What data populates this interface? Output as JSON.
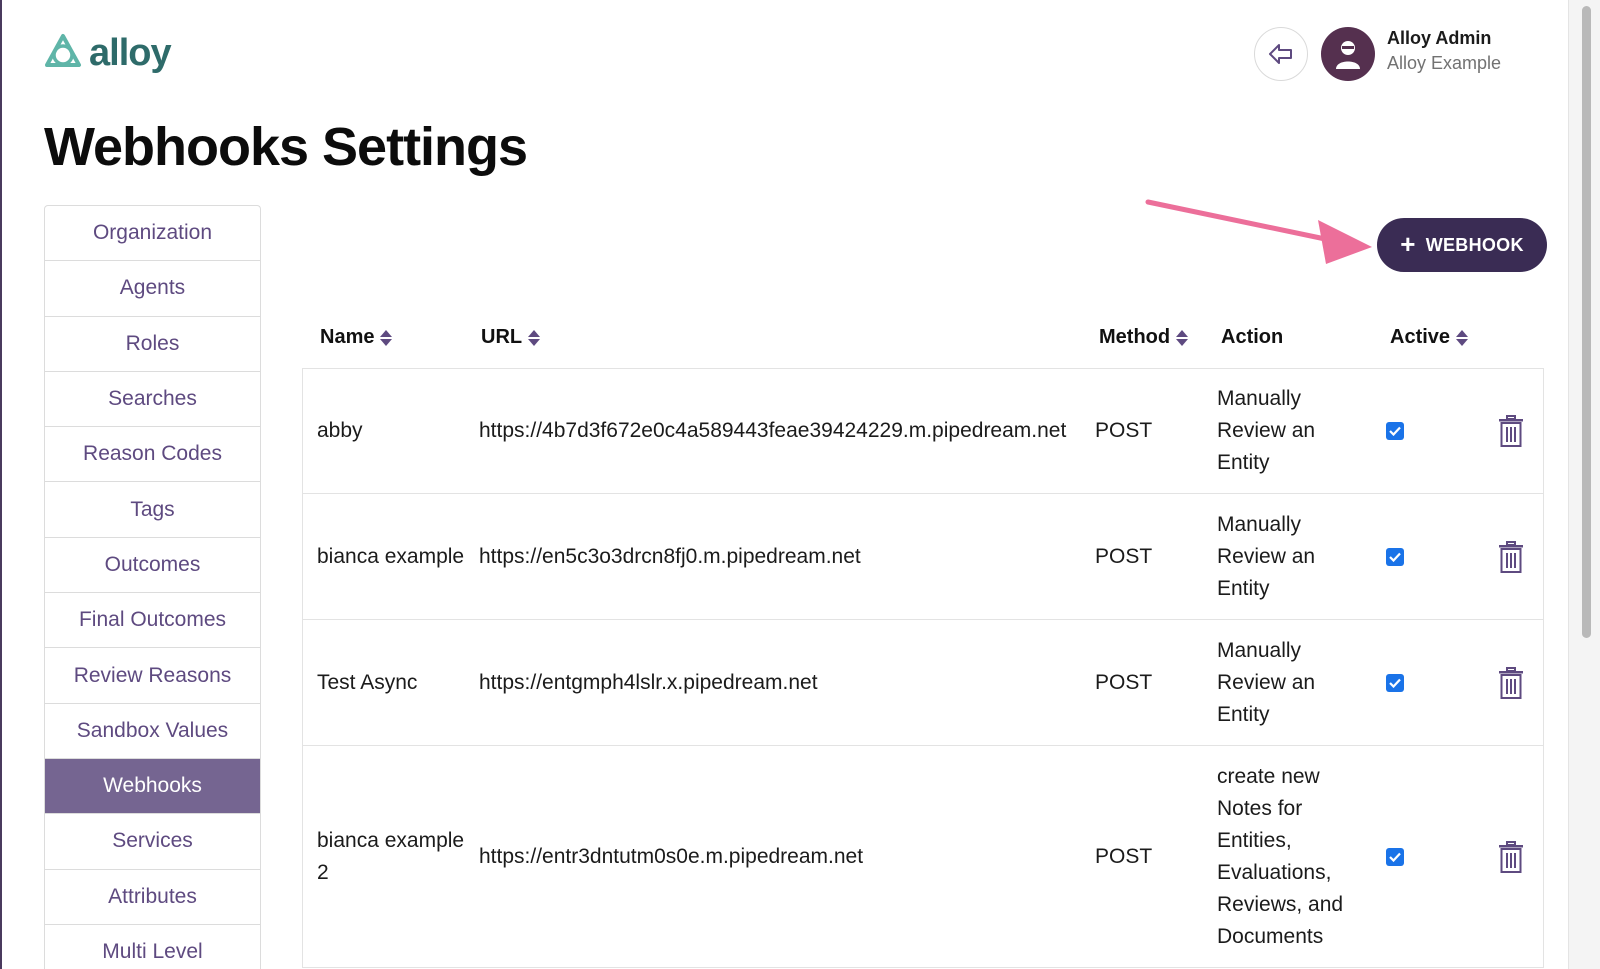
{
  "app": {
    "logo_text": "alloy"
  },
  "user": {
    "name": "Alloy Admin",
    "org": "Alloy Example"
  },
  "page": {
    "title": "Webhooks Settings"
  },
  "sidebar": {
    "items": [
      {
        "label": "Organization"
      },
      {
        "label": "Agents"
      },
      {
        "label": "Roles"
      },
      {
        "label": "Searches"
      },
      {
        "label": "Reason Codes"
      },
      {
        "label": "Tags"
      },
      {
        "label": "Outcomes"
      },
      {
        "label": "Final Outcomes"
      },
      {
        "label": "Review Reasons"
      },
      {
        "label": "Sandbox Values"
      },
      {
        "label": "Webhooks",
        "active": true
      },
      {
        "label": "Services"
      },
      {
        "label": "Attributes"
      },
      {
        "label": "Multi Level"
      }
    ]
  },
  "toolbar": {
    "add_label": "WEBHOOK",
    "add_icon": "plus-icon"
  },
  "table": {
    "headers": {
      "name": "Name",
      "url": "URL",
      "method": "Method",
      "action": "Action",
      "active": "Active"
    },
    "rows": [
      {
        "name": "abby",
        "url": "https://4b7d3f672e0c4a589443feae39424229.m.pipedream.net",
        "method": "POST",
        "action": "Manually Review an Entity",
        "active": true
      },
      {
        "name": "bianca example",
        "url": "https://en5c3o3drcn8fj0.m.pipedream.net",
        "method": "POST",
        "action": "Manually Review an Entity",
        "active": true
      },
      {
        "name": "Test Async",
        "url": "https://entgmph4lslr.x.pipedream.net",
        "method": "POST",
        "action": "Manually Review an Entity",
        "active": true
      },
      {
        "name": "bianca example 2",
        "url": "https://entr3dntutm0s0e.m.pipedream.net",
        "method": "POST",
        "action": "create new Notes for Entities, Evaluations, Reviews, and Documents",
        "active": true
      }
    ]
  },
  "colors": {
    "accent": "#3a2c54",
    "sidebar_active": "#756591",
    "link": "#5e4a80",
    "logo": "#2e6b6a",
    "annotation_arrow": "#ec6f9a"
  }
}
